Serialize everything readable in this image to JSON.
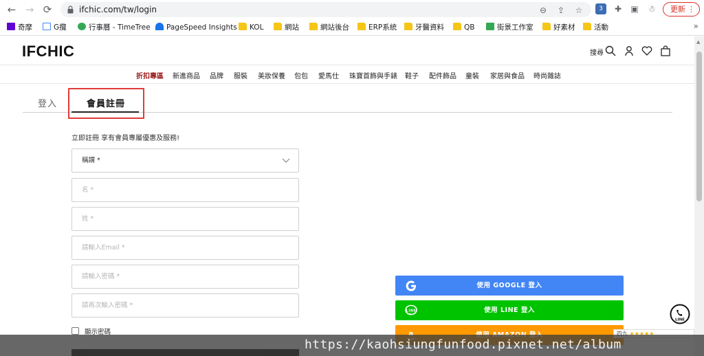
{
  "browser": {
    "url": "ifchic.com/tw/login",
    "update_label": "更新",
    "bookmarks": [
      "奇摩",
      "G攬",
      "行事曆 - TimeTree",
      "PageSpeed Insights",
      "KOL",
      "網站",
      "網站後台",
      "ERP系統",
      "牙醫資料",
      "QB",
      "街景工作室",
      "好素材",
      "活動"
    ],
    "more": "»"
  },
  "site": {
    "logo": "IFCHIC",
    "search_label": "搜尋",
    "menu": [
      "折扣專區",
      "新進商品",
      "品牌",
      "服裝",
      "美妝保養",
      "包包",
      "愛馬仕",
      "珠寶首飾與手錶",
      "鞋子",
      "配件飾品",
      "童裝",
      "家居與食品",
      "時尚雜誌"
    ]
  },
  "tabs": {
    "login": "登入",
    "register": "會員註冊"
  },
  "form": {
    "promo": "立即註冊 享有會員專屬優惠及服務!",
    "title_select": "稱謂 *",
    "first_name": "名 *",
    "last_name": "姓 *",
    "email": "請輸入Email *",
    "password": "請輸入密碼 *",
    "password_confirm": "請再次輸入密碼 *",
    "show_password": "顯示密碼"
  },
  "social": {
    "google": "使用 GOOGLE 登入",
    "line": "使用 LINE 登入",
    "amazon": "使用 AMAZON 登入",
    "line_float": "LINE"
  },
  "rating": {
    "prefix": "四九",
    "stars": "★★★★★"
  },
  "watermark": "https://kaohsiungfunfood.pixnet.net/album",
  "colors": {
    "google": "#4285f4",
    "line": "#00c300",
    "amazon": "#ff9900",
    "highlight": "#e03a3a",
    "sale": "#9b1b1b"
  }
}
